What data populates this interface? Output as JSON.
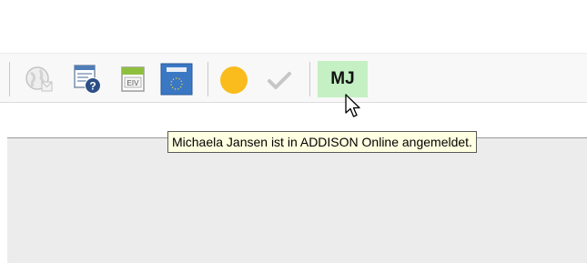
{
  "toolbar": {
    "icons": [
      {
        "name": "globe-icon",
        "state": "disabled"
      },
      {
        "name": "help-window-icon",
        "state": "enabled"
      },
      {
        "name": "elv-card-icon",
        "label": "ELV",
        "state": "enabled"
      },
      {
        "name": "eu-calculator-icon",
        "state": "enabled"
      },
      {
        "name": "status-dot-icon",
        "color": "#f9bc1c"
      },
      {
        "name": "checkmark-icon",
        "state": "disabled"
      }
    ]
  },
  "user": {
    "initials": "MJ",
    "badge_color": "#c4f0c4"
  },
  "tooltip": {
    "text": "Michaela Jansen ist in ADDISON Online angemeldet."
  },
  "colors": {
    "content_background": "#ececec",
    "tooltip_background": "#ffffe1"
  }
}
